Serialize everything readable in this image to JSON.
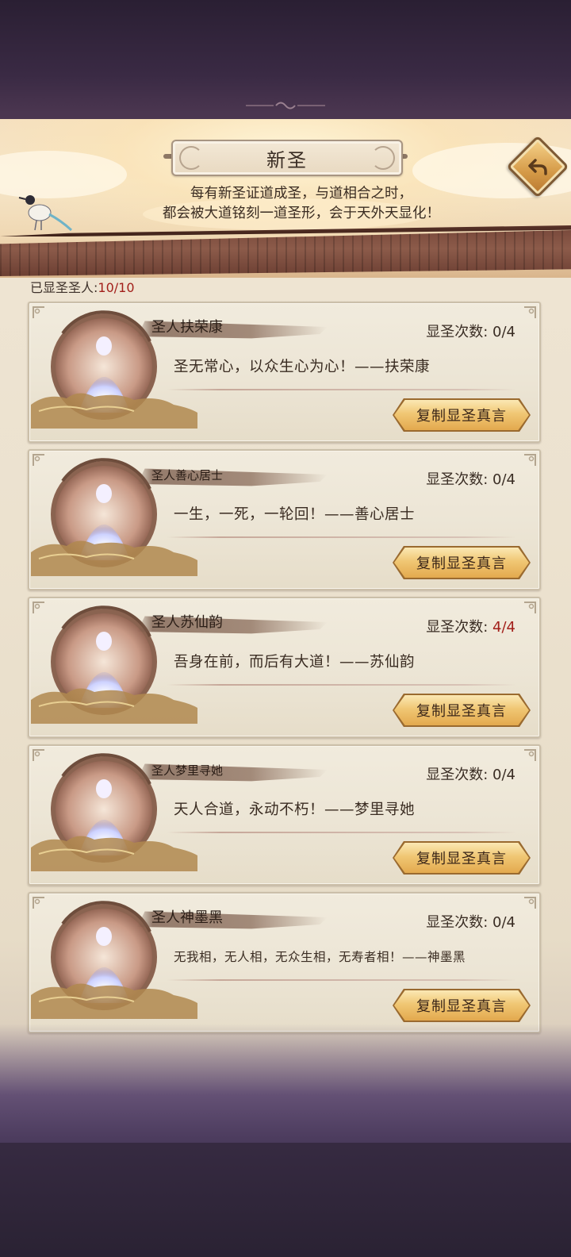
{
  "header": {
    "title": "新圣",
    "subtitle_line1": "每有新圣证道成圣，与道相合之时，",
    "subtitle_line2": "都会被大道铭刻一道圣形，会于天外天显化！"
  },
  "summary": {
    "label": "已显圣圣人:",
    "value": "10/10"
  },
  "icons": {
    "back": "back-arrow-icon",
    "avatar": "saint-portrait-icon"
  },
  "colors": {
    "accent_red": "#a21f1a",
    "button_gold": "#f0c774",
    "panel_bg": "#ece5d5"
  },
  "saints": [
    {
      "name": "圣人扶荣康",
      "times_label": "显圣次数:",
      "times_value": "0/4",
      "quote": "圣无常心，以众生心为心！——扶荣康",
      "button": "复制显圣真言"
    },
    {
      "name": "圣人善心居士",
      "times_label": "显圣次数:",
      "times_value": "0/4",
      "quote": "一生，一死，一轮回！——善心居士",
      "button": "复制显圣真言"
    },
    {
      "name": "圣人苏仙韵",
      "times_label": "显圣次数:",
      "times_value": "4/4",
      "quote": "吾身在前，而后有大道！——苏仙韵",
      "button": "复制显圣真言"
    },
    {
      "name": "圣人梦里寻她",
      "times_label": "显圣次数:",
      "times_value": "0/4",
      "quote": "天人合道，永动不朽！——梦里寻她",
      "button": "复制显圣真言"
    },
    {
      "name": "圣人神墨黑",
      "times_label": "显圣次数:",
      "times_value": "0/4",
      "quote": "无我相，无人相，无众生相，无寿者相！——神墨黑",
      "button": "复制显圣真言"
    }
  ]
}
